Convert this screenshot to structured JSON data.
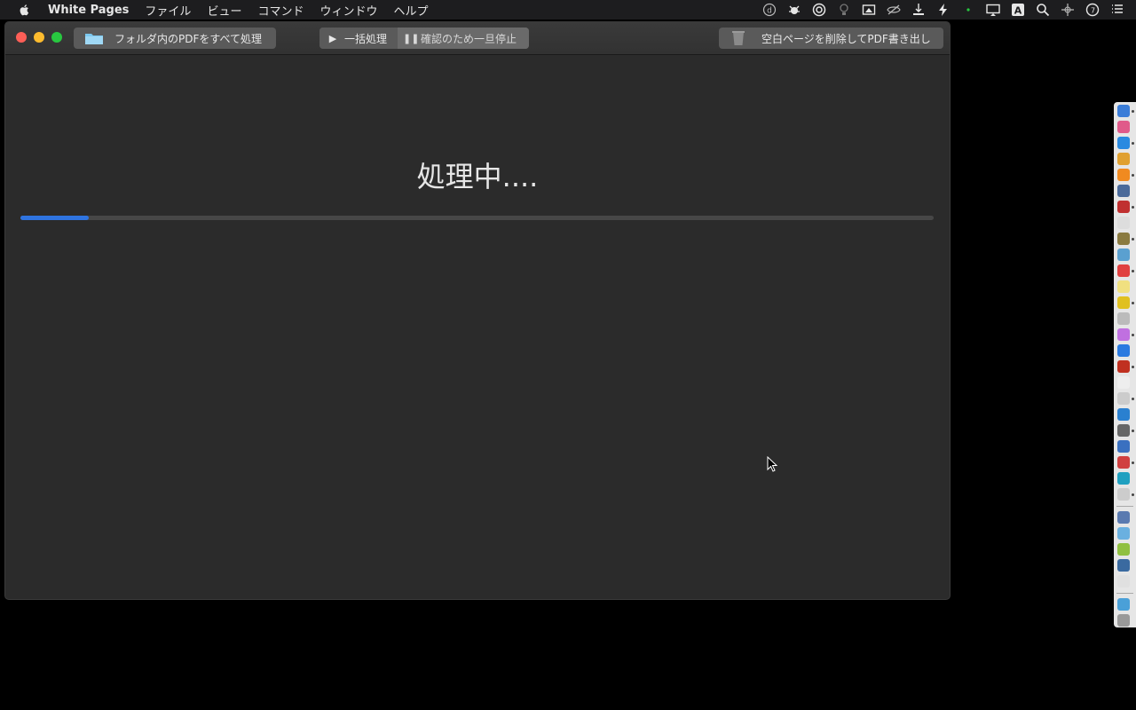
{
  "menubar": {
    "app_name": "White Pages",
    "items": [
      "ファイル",
      "ビュー",
      "コマンド",
      "ウィンドウ",
      "ヘルプ"
    ]
  },
  "toolbar": {
    "folder_label": "フォルダ内のPDFをすべて処理",
    "batch_label": "一括処理",
    "pause_label": "確認のため一旦停止",
    "export_label": "空白ページを削除してPDF書き出し"
  },
  "main": {
    "status_text": "処理中....",
    "progress": 0.075
  },
  "colors": {
    "accent": "#2f74e0",
    "window_bg": "#2b2b2b",
    "close": "#fe5f57",
    "minimize": "#febc2e",
    "maximize": "#28c840"
  }
}
